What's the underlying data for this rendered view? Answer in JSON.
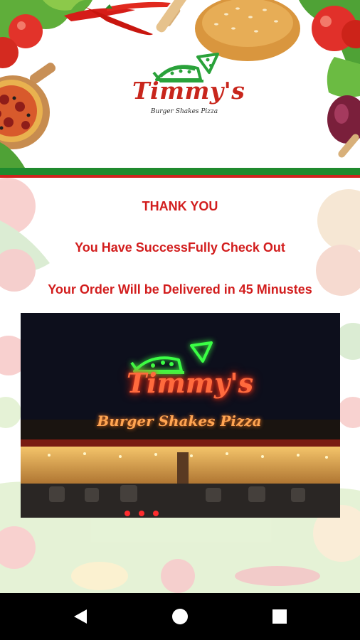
{
  "brand": {
    "name": "Timmy's",
    "tagline": "Burger Shakes Pizza"
  },
  "confirmation": {
    "thanks": "THANK YOU",
    "success": "You Have SuccessFully Check Out",
    "delivery": "Your Order Will be Delivered in 45 Minustes"
  },
  "storefront_photo": {
    "sign_name": "Timmy's",
    "sign_tagline": "Burger Shakes Pizza"
  },
  "navbar": {
    "back": "back-icon",
    "home": "home-icon",
    "recents": "recents-icon"
  },
  "colors": {
    "accent_red": "#d21d1d",
    "stripe_green": "#1f8a2e",
    "stripe_red": "#d0231f",
    "logo_green": "#2aa23a"
  }
}
